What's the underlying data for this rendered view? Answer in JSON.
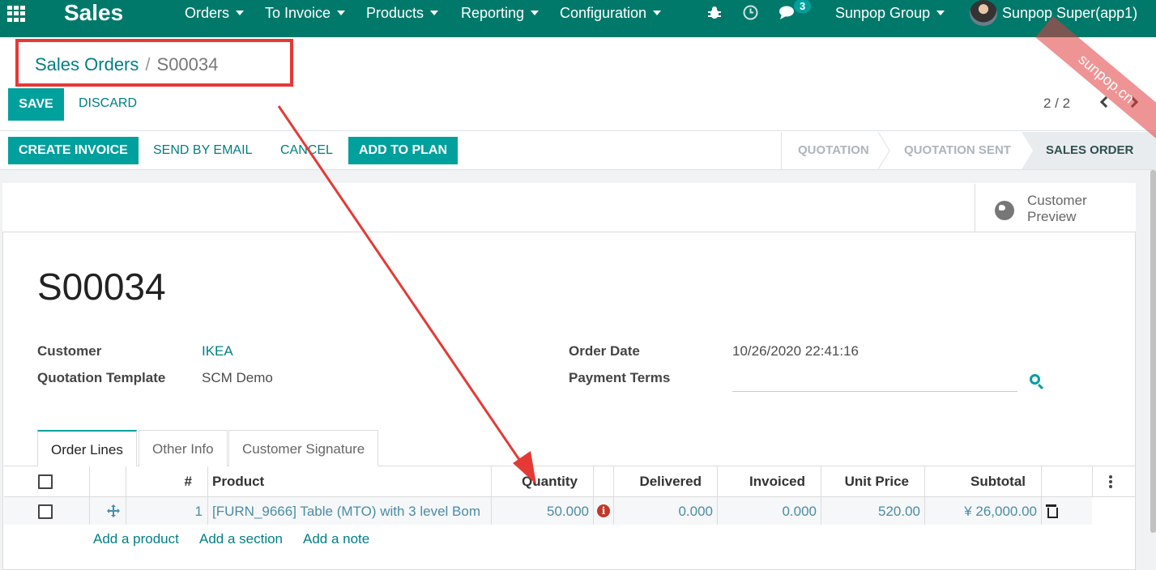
{
  "nav": {
    "brand": "Sales",
    "menus": [
      "Orders",
      "To Invoice",
      "Products",
      "Reporting",
      "Configuration"
    ],
    "chat_count": "3",
    "company": "Sunpop Group",
    "user": "Sunpop Super(app1)"
  },
  "breadcrumb": {
    "parent": "Sales Orders",
    "separator": "/",
    "current": "S00034"
  },
  "actions": {
    "save": "SAVE",
    "discard": "DISCARD"
  },
  "pager": {
    "value": "2 / 2"
  },
  "status_buttons": {
    "create_invoice": "CREATE INVOICE",
    "send_email": "SEND BY EMAIL",
    "cancel": "CANCEL",
    "add_to_plan": "ADD TO PLAN"
  },
  "stages": [
    "QUOTATION",
    "QUOTATION SENT",
    "SALES ORDER"
  ],
  "customer_preview": "Customer Preview",
  "record": {
    "name": "S00034",
    "customer_label": "Customer",
    "customer": "IKEA",
    "template_label": "Quotation Template",
    "template": "SCM Demo",
    "order_date_label": "Order Date",
    "order_date": "10/26/2020 22:41:16",
    "payment_terms_label": "Payment Terms",
    "payment_terms": ""
  },
  "tabs": [
    "Order Lines",
    "Other Info",
    "Customer Signature"
  ],
  "table": {
    "headers": {
      "num": "#",
      "product": "Product",
      "quantity": "Quantity",
      "delivered": "Delivered",
      "invoiced": "Invoiced",
      "unit_price": "Unit Price",
      "subtotal": "Subtotal"
    },
    "rows": [
      {
        "num": "1",
        "product": "[FURN_9666] Table (MTO) with 3 level Bom",
        "quantity": "50.000",
        "delivered": "0.000",
        "invoiced": "0.000",
        "unit_price": "520.00",
        "subtotal": "¥ 26,000.00"
      }
    ]
  },
  "add_links": {
    "product": "Add a product",
    "section": "Add a section",
    "note": "Add a note"
  },
  "watermark": "sunpop.cn",
  "colors": {
    "nav": "#00796b",
    "primary": "#00a09d",
    "link": "#017e84",
    "annotation": "#e53935"
  },
  "icons": [
    "apps-grid-icon",
    "bug-icon",
    "clock-icon",
    "chat-icon",
    "globe-icon",
    "search-icon",
    "move-icon",
    "info-icon",
    "trash-icon",
    "kebab-icon",
    "chevron-left-icon",
    "chevron-right-icon"
  ]
}
